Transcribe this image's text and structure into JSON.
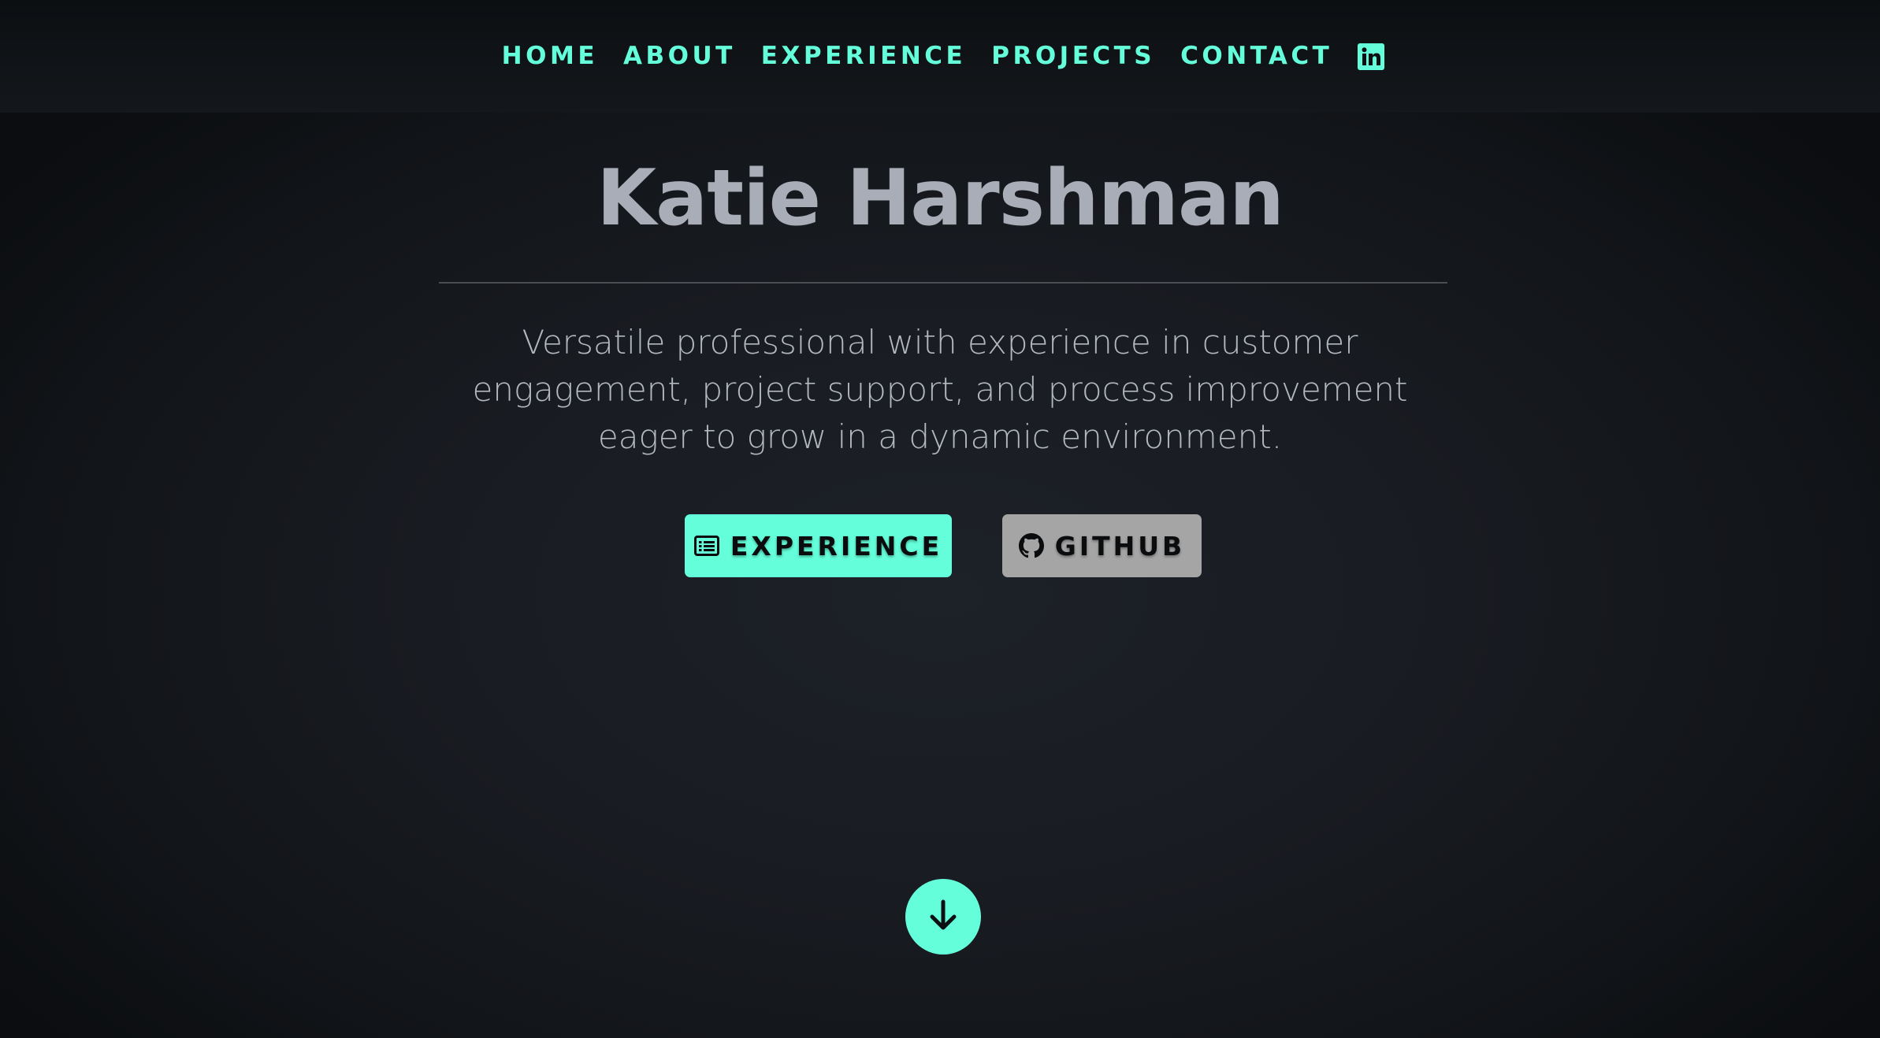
{
  "nav": {
    "items": [
      {
        "label": "HOME"
      },
      {
        "label": "ABOUT"
      },
      {
        "label": "EXPERIENCE"
      },
      {
        "label": "PROJECTS"
      },
      {
        "label": "CONTACT"
      }
    ],
    "social_icon": "linkedin-icon"
  },
  "hero": {
    "name": "Katie Harshman",
    "tagline": "Versatile professional with experience in customer engagement, project support, and process improvement eager to grow in a dynamic environment.",
    "buttons": {
      "experience": {
        "label": "EXPERIENCE",
        "icon": "list-alt-icon"
      },
      "github": {
        "label": "GITHUB",
        "icon": "github-icon"
      }
    },
    "scroll_icon": "arrow-down-icon"
  },
  "colors": {
    "accent": "#64ffda",
    "background": "#0d1013",
    "heading": "#a9adb7",
    "text": "#b3b7bf",
    "github_button": "#a5a5a5"
  }
}
